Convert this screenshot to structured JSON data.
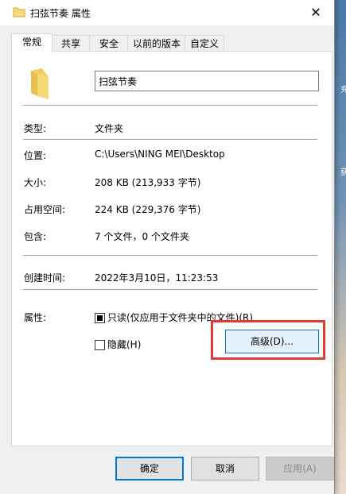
{
  "window": {
    "title": "扫弦节奏 属性"
  },
  "tabs": [
    "常规",
    "共享",
    "安全",
    "以前的版本",
    "自定义"
  ],
  "general": {
    "name_value": "扫弦节奏",
    "type": {
      "label": "类型:",
      "value": "文件夹"
    },
    "location": {
      "label": "位置:",
      "value": "C:\\Users\\NING MEI\\Desktop"
    },
    "size": {
      "label": "大小:",
      "value": "208 KB (213,933 字节)"
    },
    "size_on_disk": {
      "label": "占用空间:",
      "value": "224 KB (229,376 字节)"
    },
    "contains": {
      "label": "包含:",
      "value": "7 个文件，0 个文件夹"
    },
    "created": {
      "label": "创建时间:",
      "value": "2022年3月10日，11:23:53"
    },
    "attributes": {
      "label": "属性:",
      "readonly_label": "只读(仅应用于文件夹中的文件)(R)",
      "readonly_checked": true,
      "hidden_label": "隐藏(H)",
      "hidden_checked": false,
      "advanced_button": "高级(D)..."
    }
  },
  "footer": {
    "ok": "确定",
    "cancel": "取消",
    "apply": "应用(A)"
  },
  "background_glyphs": [
    "充",
    "获"
  ],
  "colors": {
    "accent": "#0078d7",
    "highlight": "#e53935",
    "folder": "#f8d775"
  }
}
